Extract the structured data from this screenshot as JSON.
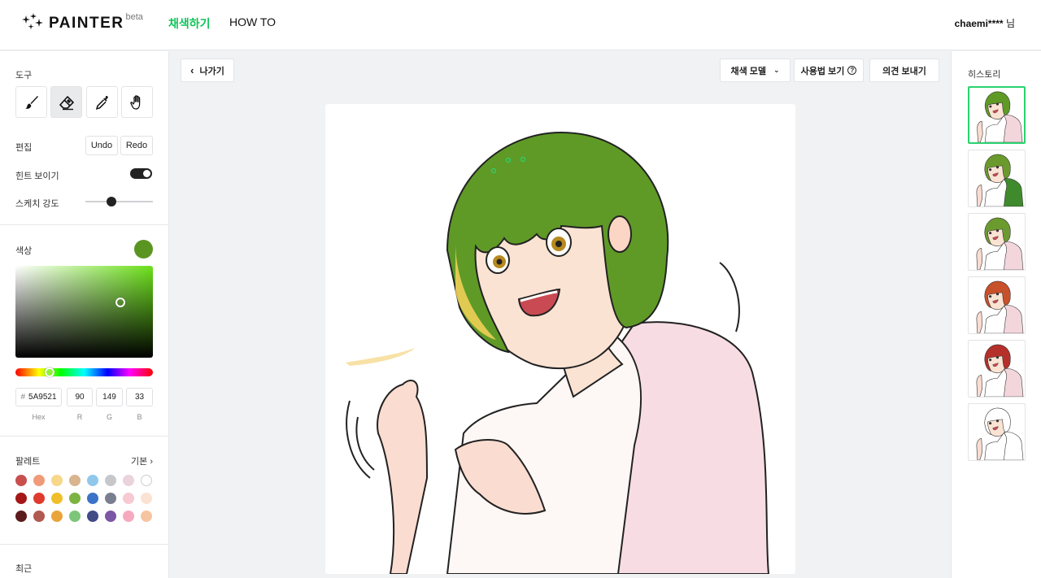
{
  "header": {
    "logo_text": "PAINTER",
    "logo_badge": "beta",
    "nav": [
      {
        "label": "채색하기",
        "active": true
      },
      {
        "label": "HOW TO",
        "active": false
      }
    ],
    "user_name": "chaemi****",
    "user_suffix": "님"
  },
  "sidebar": {
    "tools_label": "도구",
    "tools": [
      {
        "icon": "brush-icon",
        "active": false
      },
      {
        "icon": "eraser-icon",
        "active": true
      },
      {
        "icon": "eyedropper-icon",
        "active": false
      },
      {
        "icon": "hand-icon",
        "active": false
      }
    ],
    "edit_label": "편집",
    "undo_label": "Undo",
    "redo_label": "Redo",
    "hint_label": "힌트 보이기",
    "hint_on": true,
    "sketch_label": "스케치 강도",
    "color_label": "색상",
    "current_color": "#5A9521",
    "hex_value": "5A9521",
    "hex_hash": "#",
    "r_value": "90",
    "g_value": "149",
    "b_value": "33",
    "hex_caption": "Hex",
    "r_caption": "R",
    "g_caption": "G",
    "b_caption": "B",
    "palette_label": "팔레트",
    "palette_link": "기본",
    "palette": [
      [
        "#c94f4f",
        "#f19a78",
        "#f7d789",
        "#d8b48f",
        "#90c8ec",
        "#c6c7ca",
        "#ead3dc",
        "#ffffff"
      ],
      [
        "#a51717",
        "#e03a2e",
        "#efbf2b",
        "#7cb342",
        "#3c73c9",
        "#7a7f90",
        "#f7c9d3",
        "#fbe2d3"
      ],
      [
        "#5c1c1c",
        "#b05a52",
        "#e9a53a",
        "#7cc67a",
        "#414b86",
        "#7b57a5",
        "#f6a8bf",
        "#f7c4a2"
      ]
    ],
    "recent_label": "최근"
  },
  "toolbar": {
    "back_label": "나가기",
    "model_label": "채색 모델",
    "howto_label": "사용법 보기",
    "feedback_label": "의견 보내기"
  },
  "history": {
    "label": "히스토리",
    "items": [
      {
        "hair": "#5f9a27",
        "shirt": "#f3d6dc",
        "selected": true
      },
      {
        "hair": "#6a9a2c",
        "shirt": "#3f8a2c",
        "selected": false
      },
      {
        "hair": "#6b9a2e",
        "shirt": "#f3d6dc",
        "selected": false
      },
      {
        "hair": "#c8502a",
        "shirt": "#f3d6dc",
        "selected": false
      },
      {
        "hair": "#b5302a",
        "shirt": "#f3d6dc",
        "selected": false
      },
      {
        "hair": "none",
        "shirt": "none",
        "selected": false
      }
    ]
  },
  "colors": {
    "accent": "#11c45a",
    "hair_green": "#5a9521",
    "skin": "#fbe3d3",
    "shirt_pink": "#f6dbe1"
  }
}
